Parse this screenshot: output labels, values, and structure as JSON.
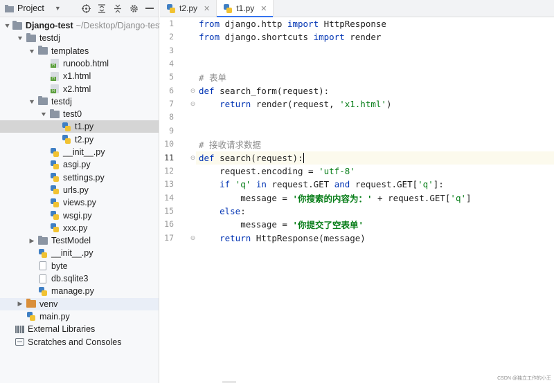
{
  "project_panel": {
    "title": "Project",
    "actions": [
      "target-icon",
      "expand-all-icon",
      "collapse-all-icon",
      "gear-icon",
      "hide-icon"
    ],
    "tree": [
      {
        "depth": 0,
        "arrow": "down",
        "icon": "folder",
        "label": "Django-test",
        "bold": true,
        "suffix": "~/Desktop/Django-test"
      },
      {
        "depth": 1,
        "arrow": "down",
        "icon": "folder",
        "label": "testdj"
      },
      {
        "depth": 2,
        "arrow": "down",
        "icon": "folder",
        "label": "templates"
      },
      {
        "depth": 3,
        "arrow": "",
        "icon": "html",
        "label": "runoob.html"
      },
      {
        "depth": 3,
        "arrow": "",
        "icon": "html",
        "label": "x1.html"
      },
      {
        "depth": 3,
        "arrow": "",
        "icon": "html",
        "label": "x2.html"
      },
      {
        "depth": 2,
        "arrow": "down",
        "icon": "folder",
        "label": "testdj"
      },
      {
        "depth": 3,
        "arrow": "down",
        "icon": "folder",
        "label": "test0"
      },
      {
        "depth": 4,
        "arrow": "",
        "icon": "py",
        "label": "t1.py",
        "selected": true
      },
      {
        "depth": 4,
        "arrow": "",
        "icon": "py",
        "label": "t2.py"
      },
      {
        "depth": 3,
        "arrow": "",
        "icon": "py",
        "label": "__init__.py"
      },
      {
        "depth": 3,
        "arrow": "",
        "icon": "py",
        "label": "asgi.py"
      },
      {
        "depth": 3,
        "arrow": "",
        "icon": "py",
        "label": "settings.py"
      },
      {
        "depth": 3,
        "arrow": "",
        "icon": "py",
        "label": "urls.py"
      },
      {
        "depth": 3,
        "arrow": "",
        "icon": "py",
        "label": "views.py"
      },
      {
        "depth": 3,
        "arrow": "",
        "icon": "py",
        "label": "wsgi.py"
      },
      {
        "depth": 3,
        "arrow": "",
        "icon": "py",
        "label": "xxx.py"
      },
      {
        "depth": 2,
        "arrow": "right",
        "icon": "folder",
        "label": "TestModel"
      },
      {
        "depth": 2,
        "arrow": "",
        "icon": "py",
        "label": "__init__.py"
      },
      {
        "depth": 2,
        "arrow": "",
        "icon": "plain",
        "label": "byte"
      },
      {
        "depth": 2,
        "arrow": "",
        "icon": "db",
        "label": "db.sqlite3"
      },
      {
        "depth": 2,
        "arrow": "",
        "icon": "py",
        "label": "manage.py"
      },
      {
        "depth": 1,
        "arrow": "right",
        "icon": "folder-orange",
        "label": "venv",
        "hover": true
      },
      {
        "depth": 1,
        "arrow": "",
        "icon": "py",
        "label": "main.py"
      },
      {
        "depth": 0,
        "arrow": "",
        "icon": "libraries",
        "label": "External Libraries"
      },
      {
        "depth": 0,
        "arrow": "",
        "icon": "scratches",
        "label": "Scratches and Consoles"
      }
    ]
  },
  "editor": {
    "tabs": [
      {
        "label": "t2.py",
        "active": false
      },
      {
        "label": "t1.py",
        "active": true
      }
    ],
    "current_line": 11,
    "lines": [
      {
        "n": "1",
        "tokens": [
          {
            "t": "from",
            "c": "kw"
          },
          {
            "t": " django.http ",
            "c": ""
          },
          {
            "t": "import",
            "c": "kw"
          },
          {
            "t": " HttpResponse",
            "c": ""
          }
        ]
      },
      {
        "n": "2",
        "tokens": [
          {
            "t": "from",
            "c": "kw"
          },
          {
            "t": " django.shortcuts ",
            "c": ""
          },
          {
            "t": "import",
            "c": "kw"
          },
          {
            "t": " render",
            "c": ""
          }
        ]
      },
      {
        "n": "3",
        "tokens": []
      },
      {
        "n": "4",
        "tokens": []
      },
      {
        "n": "5",
        "tokens": [
          {
            "t": "# 表单",
            "c": "cmt"
          }
        ]
      },
      {
        "n": "6",
        "tokens": [
          {
            "t": "def",
            "c": "kw"
          },
          {
            "t": " search_form(request):",
            "c": ""
          }
        ]
      },
      {
        "n": "7",
        "tokens": [
          {
            "t": "    ",
            "c": ""
          },
          {
            "t": "return",
            "c": "kw"
          },
          {
            "t": " render(request, ",
            "c": ""
          },
          {
            "t": "'x1.html'",
            "c": "str"
          },
          {
            "t": ")",
            "c": ""
          }
        ]
      },
      {
        "n": "8",
        "tokens": []
      },
      {
        "n": "9",
        "tokens": []
      },
      {
        "n": "10",
        "tokens": [
          {
            "t": "# 接收请求数据",
            "c": "cmt"
          }
        ]
      },
      {
        "n": "11",
        "tokens": [
          {
            "t": "def",
            "c": "kw"
          },
          {
            "t": " search(request):",
            "c": ""
          },
          {
            "t": "",
            "c": "caret"
          }
        ]
      },
      {
        "n": "12",
        "tokens": [
          {
            "t": "    request.encoding = ",
            "c": ""
          },
          {
            "t": "'utf-8'",
            "c": "str"
          }
        ]
      },
      {
        "n": "13",
        "tokens": [
          {
            "t": "    ",
            "c": ""
          },
          {
            "t": "if",
            "c": "kw"
          },
          {
            "t": " ",
            "c": ""
          },
          {
            "t": "'q'",
            "c": "str"
          },
          {
            "t": " ",
            "c": ""
          },
          {
            "t": "in",
            "c": "kw"
          },
          {
            "t": " request.GET ",
            "c": ""
          },
          {
            "t": "and",
            "c": "kw"
          },
          {
            "t": " request.GET[",
            "c": ""
          },
          {
            "t": "'q'",
            "c": "str"
          },
          {
            "t": "]:",
            "c": ""
          }
        ]
      },
      {
        "n": "14",
        "tokens": [
          {
            "t": "        message = ",
            "c": ""
          },
          {
            "t": "'你搜索的内容为：'",
            "c": "bstr"
          },
          {
            "t": " + request.GET[",
            "c": ""
          },
          {
            "t": "'q'",
            "c": "str"
          },
          {
            "t": "]",
            "c": ""
          }
        ]
      },
      {
        "n": "15",
        "tokens": [
          {
            "t": "    ",
            "c": ""
          },
          {
            "t": "else",
            "c": "kw"
          },
          {
            "t": ":",
            "c": ""
          }
        ]
      },
      {
        "n": "16",
        "tokens": [
          {
            "t": "        message = ",
            "c": ""
          },
          {
            "t": "'你提交了空表单'",
            "c": "bstr"
          }
        ]
      },
      {
        "n": "17",
        "tokens": [
          {
            "t": "    ",
            "c": ""
          },
          {
            "t": "return",
            "c": "kw"
          },
          {
            "t": " HttpResponse(message)",
            "c": ""
          }
        ]
      }
    ],
    "fold_lines": [
      "6",
      "7",
      "11",
      "17"
    ]
  },
  "watermark": "CSDN @独立工作的小王"
}
